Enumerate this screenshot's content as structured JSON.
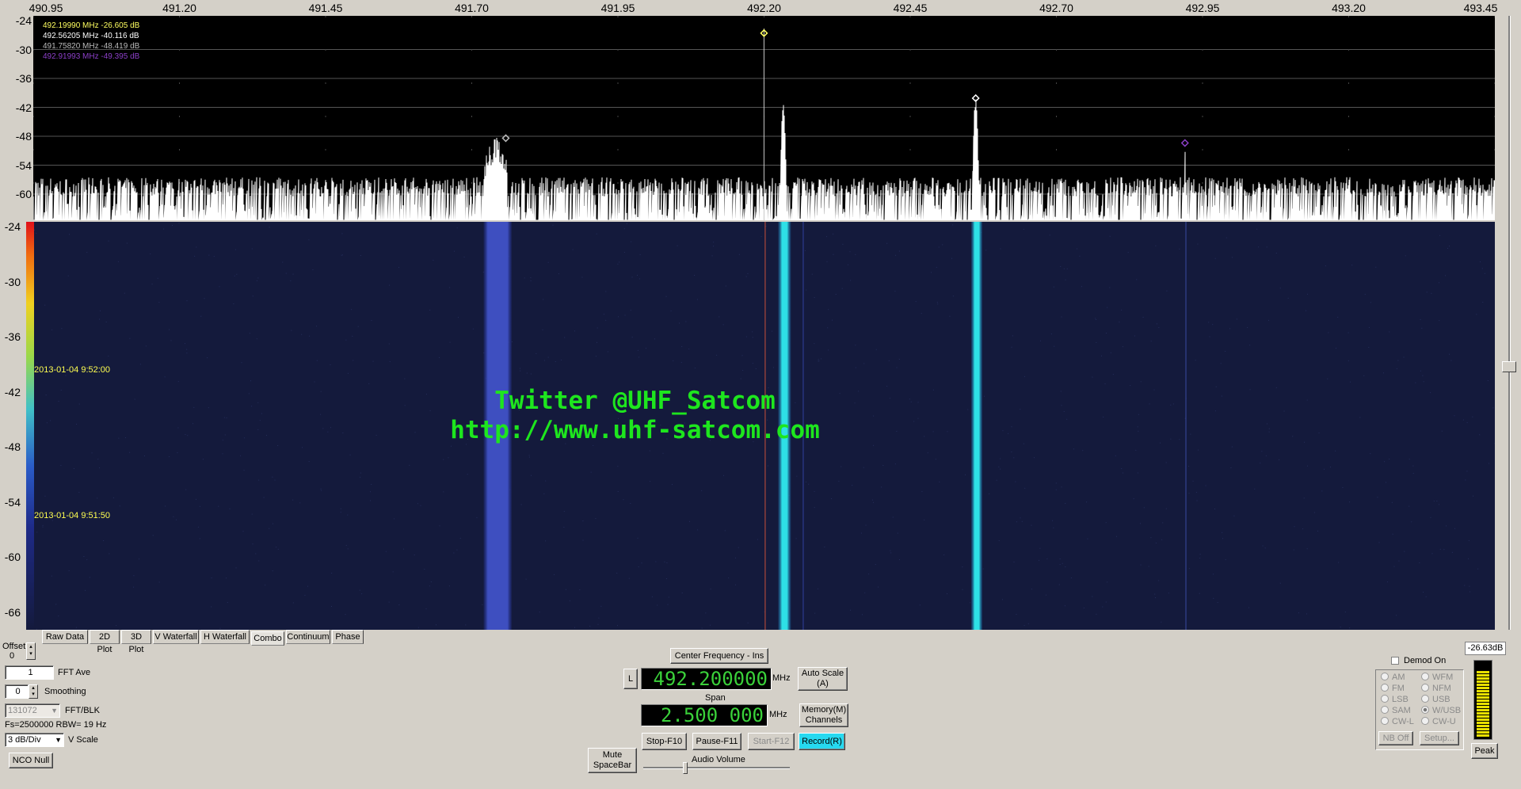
{
  "x_axis": {
    "ticks": [
      "490.95",
      "491.20",
      "491.45",
      "491.70",
      "491.95",
      "492.20",
      "492.45",
      "492.70",
      "492.95",
      "493.20",
      "493.45"
    ]
  },
  "spectrum": {
    "y_ticks": [
      "-24",
      "-30",
      "-36",
      "-42",
      "-48",
      "-54",
      "-60"
    ],
    "markers": [
      {
        "text": "492.19990 MHz  -26.605 dB",
        "color": "#ffff60"
      },
      {
        "text": "492.56205 MHz  -40.116 dB",
        "color": "#ffffff"
      },
      {
        "text": "491.75820 MHz  -48.419 dB",
        "color": "#bbbbbb"
      },
      {
        "text": "492.91993 MHz  -49.395 dB",
        "color": "#8c3fc8"
      }
    ]
  },
  "waterfall": {
    "y_ticks": [
      "-24",
      "-30",
      "-36",
      "-42",
      "-48",
      "-54",
      "-60",
      "-66"
    ],
    "timestamps": [
      "2013-01-04 9:52:00",
      "2013-01-04 9:51:50"
    ],
    "watermark_line1": "Twitter @UHF_Satcom",
    "watermark_line2": "http://www.uhf-satcom.com"
  },
  "tabs": [
    "Raw Data",
    "2D Plot",
    "3D Plot",
    "V Waterfall",
    "H Waterfall",
    "Combo",
    "Continuum",
    "Phase"
  ],
  "active_tab": "Combo",
  "left_panel": {
    "offset_label": "Offset",
    "offset_value": "0",
    "fft_ave_value": "1",
    "fft_ave_label": "FFT Ave",
    "smoothing_value": "0",
    "smoothing_label": "Smoothing",
    "fft_blk_value": "131072",
    "fft_blk_label": "FFT/BLK",
    "fs_rbw": "Fs=2500000 RBW= 19 Hz",
    "vscale_value": "3 dB/Div",
    "vscale_label": "V Scale",
    "nco_null": "NCO Null"
  },
  "center": {
    "center_freq_button": "Center Frequency - Ins",
    "l_button": "L",
    "center_freq": "492.200000",
    "mhz1": "MHz",
    "span_label": "Span",
    "span": "2.500 000",
    "mhz2": "MHz",
    "auto_scale": "Auto Scale (A)",
    "memory": "Memory(M) Channels",
    "mute": "Mute SpaceBar",
    "stop": "Stop-F10",
    "pause": "Pause-F11",
    "start": "Start-F12",
    "record": "Record(R)",
    "audio_volume_label": "Audio Volume",
    "audio_volume": 0.27
  },
  "right_panel": {
    "demod_label": "Demod On",
    "modes_left": [
      "AM",
      "FM",
      "LSB",
      "SAM",
      "CW-L"
    ],
    "modes_right": [
      "WFM",
      "NFM",
      "USB",
      "W/USB",
      "CW-U"
    ],
    "selected_mode": "W/USB",
    "nb_off": "NB Off",
    "setup": "Setup...",
    "level_readout": "-26.63dB",
    "peak_button": "Peak",
    "level_fraction": 0.9
  },
  "colors": {
    "signal_cyan": "#2ee0e6",
    "waterfall_bg": "#141a3c",
    "watermark": "#1ee61e",
    "record_active": "#26d9f0",
    "lcd_green": "#3ad13a"
  }
}
